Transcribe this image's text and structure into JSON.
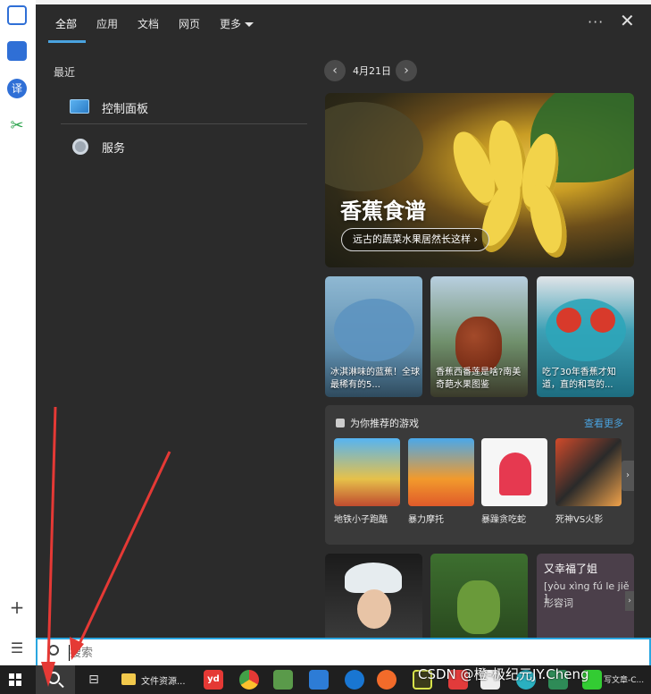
{
  "tabs": [
    {
      "label": "全部"
    },
    {
      "label": "应用"
    },
    {
      "label": "文档"
    },
    {
      "label": "网页"
    },
    {
      "label": "更多"
    }
  ],
  "header": {
    "more_dots": "···",
    "close": "✕"
  },
  "recent": {
    "label": "最近",
    "items": [
      {
        "label": "控制面板",
        "icon": "control-panel-icon"
      },
      {
        "label": "服务",
        "icon": "services-gear-icon"
      }
    ]
  },
  "date_nav": {
    "prev": "‹",
    "date": "4月21日",
    "next": "›"
  },
  "hero": {
    "title": "香蕉食谱",
    "pill": "远古的蔬菜水果居然长这样 ›"
  },
  "cards": [
    {
      "text": "冰淇淋味的蓝蕉！全球最稀有的5..."
    },
    {
      "text": "香蕉西番莲是啥?南美奇葩水果图鉴"
    },
    {
      "text": "吃了30年香蕉才知道，直的和弯的..."
    }
  ],
  "games": {
    "title": "为你推荐的游戏",
    "more": "查看更多",
    "items": [
      {
        "label": "地铁小子跑酷"
      },
      {
        "label": "暴力摩托"
      },
      {
        "label": "暴躁贪吃蛇"
      },
      {
        "label": "死神VS火影"
      }
    ],
    "arrow": "›"
  },
  "word_card": {
    "word": "又幸福了姐",
    "pinyin": "[yòu xìng fú le jiě ]",
    "type": "形容词",
    "arrow": "›"
  },
  "search": {
    "placeholder": "搜索",
    "value": ""
  },
  "taskbar": {
    "task_view_icon": "⊟",
    "explorer_label": "文件资源...",
    "youdao_label": "yd",
    "last_label": "写文章-C..."
  },
  "watermark": "CSDN @橙-极纪元JY.Cheng",
  "left_strip": {
    "translate": "译",
    "plus": "+",
    "list": "☰"
  },
  "colors": {
    "panel_bg": "#2b2b2b",
    "accent": "#4aa3df",
    "search_border": "#2aa6e0",
    "taskbar": "#1f1f1f",
    "annotation": "#e53935"
  }
}
